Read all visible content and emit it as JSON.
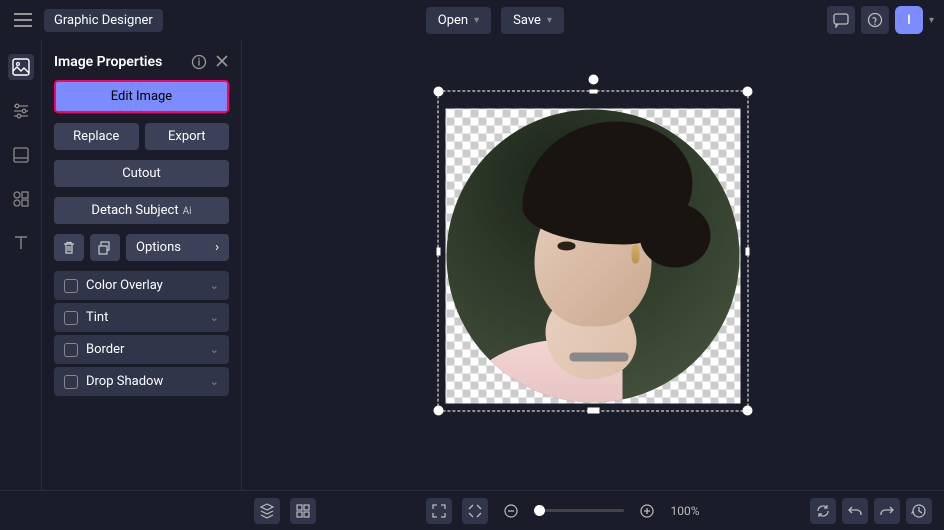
{
  "app_title": "Graphic Designer",
  "topbar": {
    "open": "Open",
    "save": "Save",
    "avatar_initial": "I"
  },
  "panel": {
    "title": "Image Properties",
    "edit_image": "Edit Image",
    "replace": "Replace",
    "export": "Export",
    "cutout": "Cutout",
    "detach_subject": "Detach Subject",
    "ai_badge": "Ai",
    "options": "Options",
    "effects": [
      {
        "label": "Color Overlay"
      },
      {
        "label": "Tint"
      },
      {
        "label": "Border"
      },
      {
        "label": "Drop Shadow"
      }
    ]
  },
  "zoom": {
    "percent": "100%"
  }
}
